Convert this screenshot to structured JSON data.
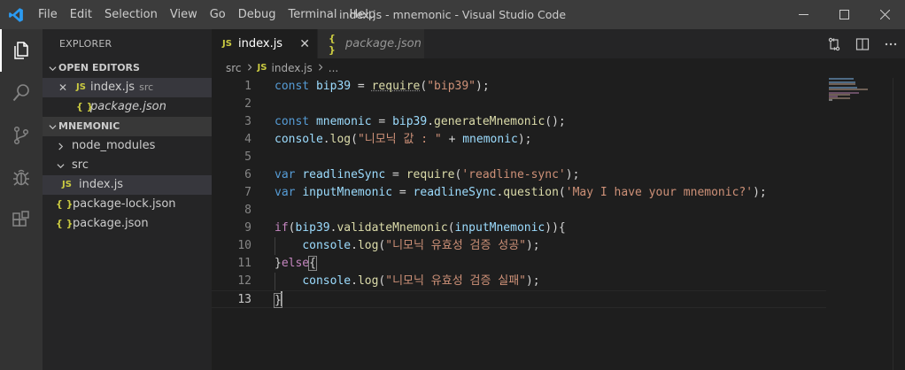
{
  "window": {
    "title": "index.js - mnemonic - Visual Studio Code"
  },
  "menu": [
    "File",
    "Edit",
    "Selection",
    "View",
    "Go",
    "Debug",
    "Terminal",
    "Help"
  ],
  "sidebar": {
    "title": "EXPLORER",
    "open_editors": {
      "label": "OPEN EDITORS",
      "items": [
        {
          "close": "✕",
          "badge": "JS",
          "name": "index.js",
          "hint": "src"
        },
        {
          "badge": "{ }",
          "name": "package.json"
        }
      ]
    },
    "project": {
      "label": "MNEMONIC",
      "items": [
        {
          "name": "node_modules"
        },
        {
          "name": "src"
        },
        {
          "badge": "JS",
          "name": "index.js"
        },
        {
          "badge": "{ }",
          "name": "package-lock.json"
        },
        {
          "badge": "{ }",
          "name": "package.json"
        }
      ]
    }
  },
  "tabs": [
    {
      "badge": "JS",
      "name": "index.js",
      "close": "✕"
    },
    {
      "badge": "{ }",
      "name": "package.json"
    }
  ],
  "breadcrumb": {
    "folder": "src",
    "badge": "JS",
    "file": "index.js",
    "more": "..."
  },
  "editor": {
    "lines": [
      {
        "n": "1"
      },
      {
        "n": "2"
      },
      {
        "n": "3"
      },
      {
        "n": "4"
      },
      {
        "n": "5"
      },
      {
        "n": "6"
      },
      {
        "n": "7"
      },
      {
        "n": "8"
      },
      {
        "n": "9"
      },
      {
        "n": "10"
      },
      {
        "n": "11"
      },
      {
        "n": "12"
      },
      {
        "n": "13"
      }
    ],
    "tokens": {
      "l1": [
        "const",
        " ",
        "bip39",
        " = ",
        "require",
        "(",
        "\"bip39\"",
        ");"
      ],
      "l3": [
        "const",
        " ",
        "mnemonic",
        " = ",
        "bip39",
        ".",
        "generateMnemonic",
        "();"
      ],
      "l4": [
        "console",
        ".",
        "log",
        "(",
        "\"니모닉 값 : \"",
        " + ",
        "mnemonic",
        ");"
      ],
      "l6": [
        "var",
        " ",
        "readlineSync",
        " = ",
        "require",
        "(",
        "'readline-sync'",
        ");"
      ],
      "l7": [
        "var",
        " ",
        "inputMnemonic",
        " = ",
        "readlineSync",
        ".",
        "question",
        "(",
        "'May I have your mnemonic?'",
        ");"
      ],
      "l9": [
        "if",
        "(",
        "bip39",
        ".",
        "validateMnemonic",
        "(",
        "inputMnemonic",
        ")){"
      ],
      "l10": [
        "    ",
        "console",
        ".",
        "log",
        "(",
        "\"니모닉 유효성 검증 성공\"",
        ");"
      ],
      "l11": [
        "}",
        "else",
        "{"
      ],
      "l12": [
        "    ",
        "console",
        ".",
        "log",
        "(",
        "\"니모닉 유효성 검증 실패\"",
        ");"
      ],
      "l13": [
        "}"
      ]
    }
  },
  "colors": {
    "keyword": "#569cd6",
    "control": "#c586c0",
    "variable": "#9cdcfe",
    "function": "#dcdcaa",
    "string": "#ce9178",
    "js_badge": "#cbcb41"
  }
}
